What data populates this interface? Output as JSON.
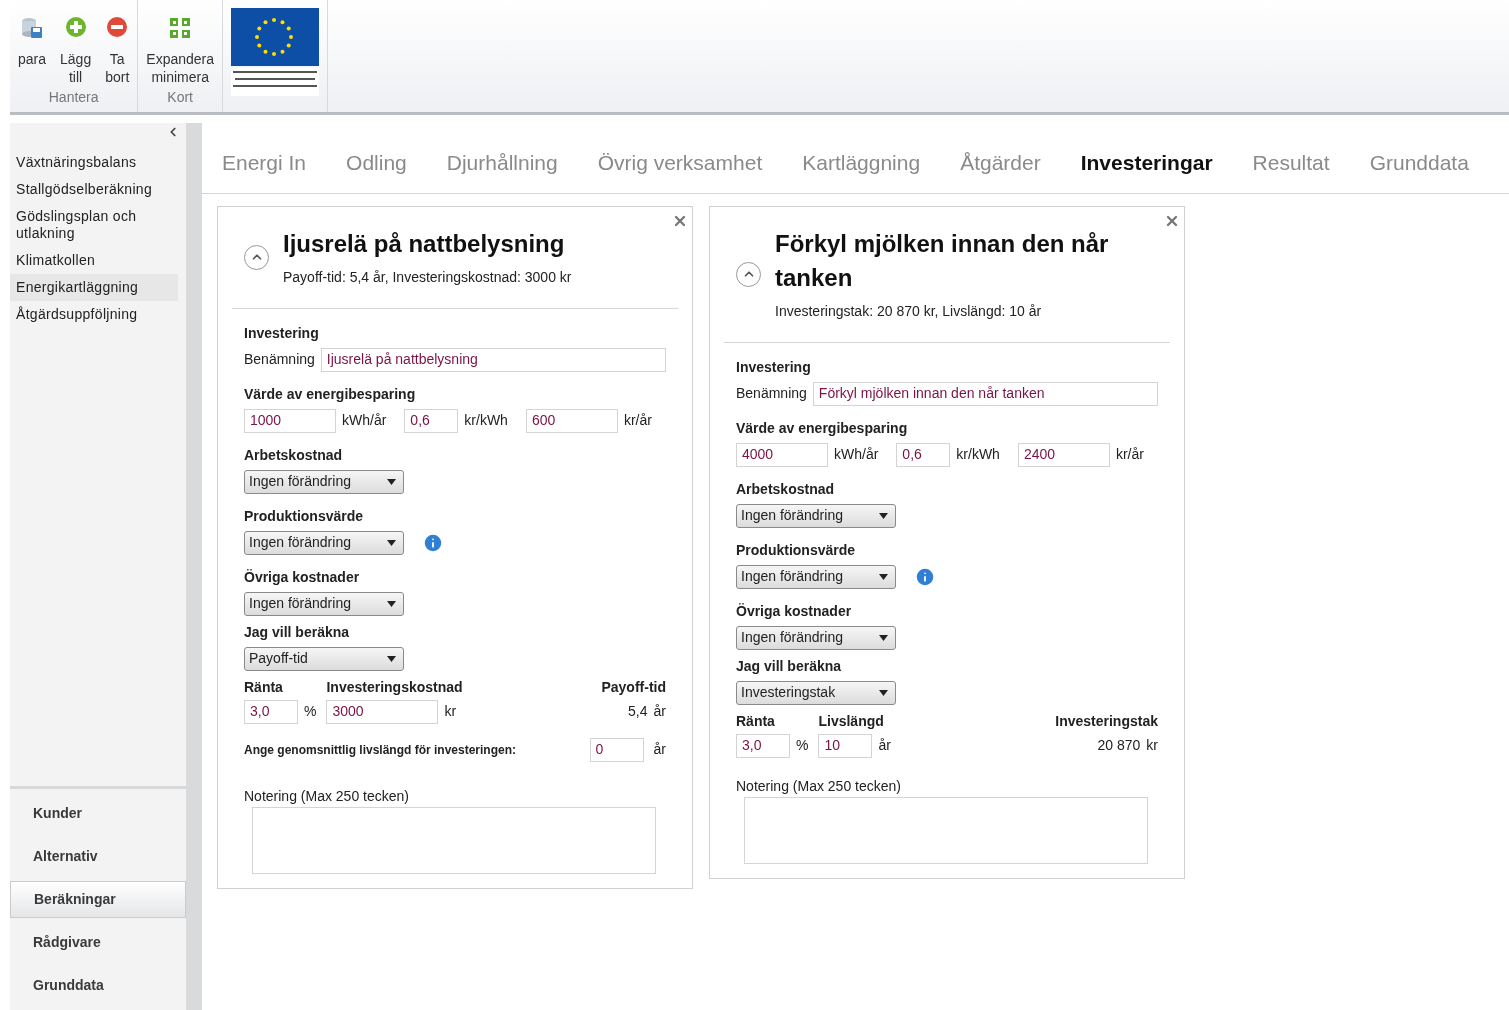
{
  "ribbon": {
    "groups": [
      {
        "label": "Hantera",
        "buttons": [
          {
            "kind": "save",
            "lines": [
              "para"
            ]
          },
          {
            "kind": "add",
            "lines": [
              "Lägg",
              "till"
            ]
          },
          {
            "kind": "remove",
            "lines": [
              "Ta",
              "bort"
            ]
          }
        ]
      },
      {
        "label": "Kort",
        "buttons": [
          {
            "kind": "expand",
            "lines": [
              "Expandera",
              "minimera"
            ]
          }
        ]
      }
    ]
  },
  "sidebar": {
    "items": [
      {
        "label": "Växtnäringsbalans",
        "selected": false
      },
      {
        "label": "Stallgödselberäkning",
        "selected": false
      },
      {
        "label": "Gödslingsplan och utlakning",
        "selected": false
      },
      {
        "label": "Klimatkollen",
        "selected": false
      },
      {
        "label": "Energikartläggning",
        "selected": true
      },
      {
        "label": "Åtgärdsuppföljning",
        "selected": false
      }
    ],
    "nav": [
      {
        "label": "Kunder",
        "selected": false
      },
      {
        "label": "Alternativ",
        "selected": false
      },
      {
        "label": "Beräkningar",
        "selected": true
      },
      {
        "label": "Rådgivare",
        "selected": false
      },
      {
        "label": "Grunddata",
        "selected": false
      }
    ]
  },
  "tabs": [
    {
      "label": "Energi In",
      "selected": false
    },
    {
      "label": "Odling",
      "selected": false
    },
    {
      "label": "Djurhållning",
      "selected": false
    },
    {
      "label": "Övrig verksamhet",
      "selected": false
    },
    {
      "label": "Kartläggning",
      "selected": false
    },
    {
      "label": "Åtgärder",
      "selected": false
    },
    {
      "label": "Investeringar",
      "selected": true
    },
    {
      "label": "Resultat",
      "selected": false
    },
    {
      "label": "Grunddata",
      "selected": false
    }
  ],
  "cards": [
    {
      "title": "Ijusrelä på nattbelysning",
      "summary": "Payoff-tid: 5,4 år, Investeringskostnad: 3000 kr",
      "section": "Investering",
      "name_label": "Benämning",
      "name_value": "Ijusrelä på nattbelysning",
      "saving_label": "Värde av energibesparing",
      "saving": [
        {
          "value": "1000",
          "unit": "kWh/år"
        },
        {
          "value": "0,6",
          "unit": "kr/kWh"
        },
        {
          "value": "600",
          "unit": "kr/år"
        }
      ],
      "selects": [
        {
          "label": "Arbetskostnad",
          "value": "Ingen förändring",
          "info": false
        },
        {
          "label": "Produktionsvärde",
          "value": "Ingen förändring",
          "info": true
        },
        {
          "label": "Övriga kostnader",
          "value": "Ingen förändring",
          "info": false
        },
        {
          "label": "Jag vill beräkna",
          "value": "Payoff-tid",
          "info": false
        }
      ],
      "calc": [
        {
          "label": "Ränta",
          "value": "3,0",
          "unit": "%"
        },
        {
          "label": "Investeringskostnad",
          "value": "3000",
          "unit": "kr"
        }
      ],
      "result": {
        "label": "Payoff-tid",
        "value": "5,4",
        "unit": "år"
      },
      "lifetime": {
        "label": "Ange genomsnittlig livslängd för investeringen:",
        "value": "0",
        "unit": "år"
      },
      "note_label": "Notering (Max 250 tecken)"
    },
    {
      "title": "Förkyl mjölken innan den når tanken",
      "summary": "Investeringstak: 20 870 kr, Livslängd: 10 år",
      "section": "Investering",
      "name_label": "Benämning",
      "name_value": "Förkyl mjölken innan den når tanken",
      "saving_label": "Värde av energibesparing",
      "saving": [
        {
          "value": "4000",
          "unit": "kWh/år"
        },
        {
          "value": "0,6",
          "unit": "kr/kWh"
        },
        {
          "value": "2400",
          "unit": "kr/år"
        }
      ],
      "selects": [
        {
          "label": "Arbetskostnad",
          "value": "Ingen förändring",
          "info": false
        },
        {
          "label": "Produktionsvärde",
          "value": "Ingen förändring",
          "info": true
        },
        {
          "label": "Övriga kostnader",
          "value": "Ingen förändring",
          "info": false
        },
        {
          "label": "Jag vill beräkna",
          "value": "Investeringstak",
          "info": false
        }
      ],
      "calc": [
        {
          "label": "Ränta",
          "value": "3,0",
          "unit": "%"
        },
        {
          "label": "Livslängd",
          "value": "10",
          "unit": "år"
        }
      ],
      "result": {
        "label": "Investeringstak",
        "value": "20 870",
        "unit": "kr"
      },
      "note_label": "Notering (Max 250 tecken)"
    }
  ]
}
